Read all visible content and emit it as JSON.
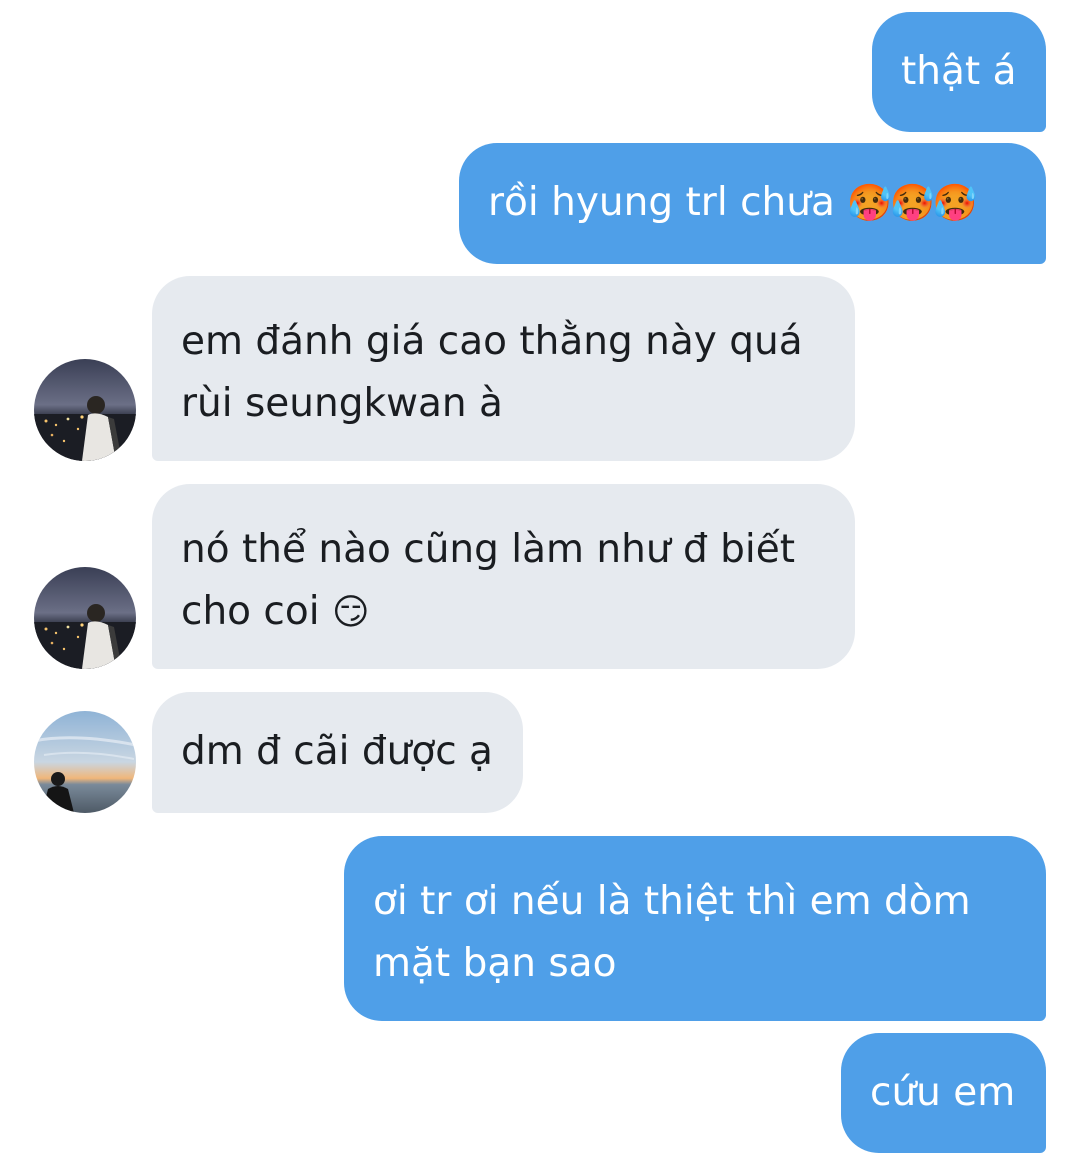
{
  "conversation": {
    "messages": [
      {
        "side": "outgoing",
        "text": "thật á"
      },
      {
        "side": "outgoing",
        "text": "rồi hyung trl chưa",
        "emoji": "🥵🥵🥵"
      },
      {
        "side": "incoming",
        "line1": "em đánh giá cao thằng này quá",
        "line2": "rùi seungkwan à",
        "avatar": "night-city-avatar"
      },
      {
        "side": "incoming",
        "line1": "nó thể nào cũng làm như đ biết",
        "line2": "cho coi",
        "emoji": "😏",
        "avatar": "night-city-avatar"
      },
      {
        "side": "incoming",
        "text": "dm đ cãi được ạ",
        "avatar": "sunset-sea-avatar"
      },
      {
        "side": "outgoing",
        "line1": "ơi tr ơi nếu là thiệt thì em dòm",
        "line2": "mặt bạn sao"
      },
      {
        "side": "outgoing",
        "text": "cứu em"
      }
    ]
  },
  "colors": {
    "outgoing_bubble": "#4f9fe8",
    "incoming_bubble": "#e6eaef",
    "incoming_text": "#1a1d21",
    "outgoing_text": "#ffffff"
  }
}
